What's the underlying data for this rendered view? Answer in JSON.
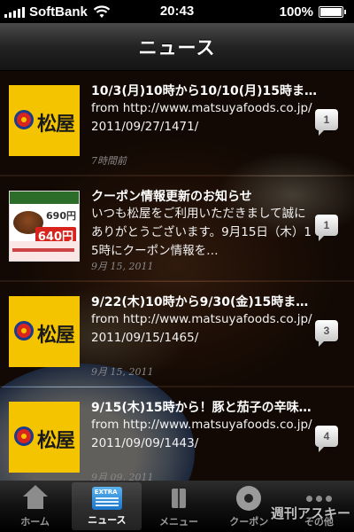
{
  "status_bar": {
    "carrier": "SoftBank",
    "time": "20:43",
    "battery": "100%",
    "battery_level": 1.0
  },
  "nav": {
    "title": "ニュース"
  },
  "news": [
    {
      "title": "10/3(月)10時から10/10(月)15時まで…",
      "body": "from http://www.matsuyafoods.co.jp/2011/09/27/1471/",
      "date": "7時間前",
      "count": "1",
      "logo": "松屋"
    },
    {
      "title": "クーポン情報更新のお知らせ",
      "body": "いつも松屋をご利用いただきまして誠にありがとうございます。9月15日（木）15時にクーポン情報を…",
      "date": "9月 15, 2011",
      "count": "1",
      "coupon": {
        "price_old": "690円",
        "price": "640円"
      }
    },
    {
      "title": "9/22(木)10時から9/30(金)15時まで…",
      "body": "from http://www.matsuyafoods.co.jp/2011/09/15/1465/",
      "date": "9月 15, 2011",
      "count": "3",
      "logo": "松屋"
    },
    {
      "title": "9/15(木)15時から！豚と茄子の辛味…",
      "body": "from http://www.matsuyafoods.co.jp/2011/09/09/1443/",
      "date": "9月 09, 2011",
      "count": "4",
      "logo": "松屋"
    }
  ],
  "tabs": [
    {
      "label": "ホーム",
      "icon": "home-icon"
    },
    {
      "label": "ニュース",
      "icon": "news-icon",
      "active": true
    },
    {
      "label": "メニュー",
      "icon": "menu-icon"
    },
    {
      "label": "クーポン",
      "icon": "coupon-icon"
    },
    {
      "label": "その他",
      "icon": "more-icon"
    }
  ],
  "watermark": "週刊アスキー",
  "colors": {
    "logo_yellow": "#f5c400",
    "logo_red": "#d9261c",
    "logo_blue": "#1b3b8c"
  }
}
